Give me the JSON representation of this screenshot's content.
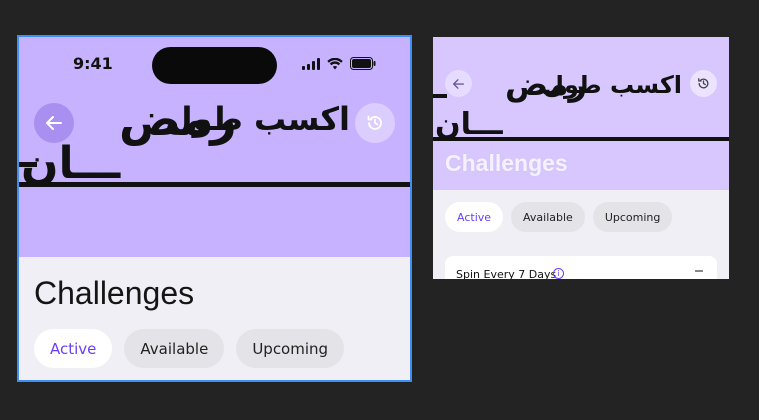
{
  "frame1": {
    "status": {
      "time": "9:41"
    },
    "hero": {
      "arabic_title": "اكسب طول",
      "arabic_big": "رمض",
      "arabic_tail": "ـــان"
    },
    "page_title": "Challenges",
    "tabs": [
      {
        "label": "Active",
        "selected": true
      },
      {
        "label": "Available",
        "selected": false
      },
      {
        "label": "Upcoming",
        "selected": false
      }
    ]
  },
  "frame2": {
    "hero": {
      "arabic_title": "اكسب طول",
      "arabic_big": "رمض",
      "arabic_tail": "ـــان"
    },
    "page_title": "Challenges",
    "tabs": [
      {
        "label": "Active",
        "selected": true
      },
      {
        "label": "Available",
        "selected": false
      },
      {
        "label": "Upcoming",
        "selected": false
      }
    ],
    "card": {
      "title": "Spin Every 7 Days"
    }
  },
  "colors": {
    "hero_purple": "#c7b2ff",
    "hero_purple_light": "#d8c7ff",
    "accent": "#6a3ff2",
    "page_bg": "#f0eff5",
    "canvas_bg": "#232323",
    "selection_outline": "#3d8ef7"
  },
  "icons": [
    "back-arrow-icon",
    "history-icon",
    "signal-icon",
    "wifi-icon",
    "battery-icon",
    "info-icon"
  ]
}
